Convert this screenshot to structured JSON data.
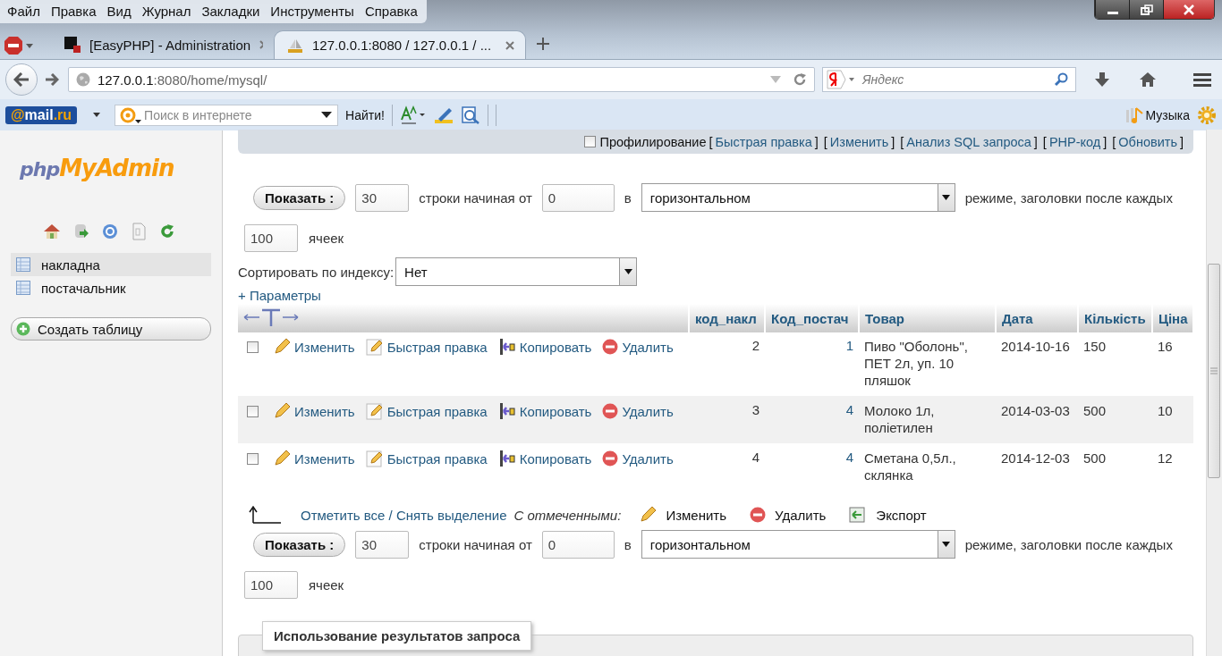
{
  "menu": [
    "Файл",
    "Правка",
    "Вид",
    "Журнал",
    "Закладки",
    "Инструменты",
    "Справка"
  ],
  "tabs": [
    {
      "title": "[EasyPHP] - Administration",
      "selected": false
    },
    {
      "title": "127.0.0.1:8080 / 127.0.0.1 / ...",
      "selected": true
    }
  ],
  "address": {
    "host": "127.0.0.1",
    "rest": ":8080/home/mysql/"
  },
  "search": {
    "placeholder": "Яндекс"
  },
  "mailbar": {
    "logo_at": "@",
    "logo_mail": "mail",
    "logo_ru": ".ru",
    "search_placeholder": "Поиск в интернете",
    "find": "Найти!",
    "music": "Музыка"
  },
  "sidebar": {
    "logo_php": "php",
    "logo_rest": "MyAdmin",
    "tables": [
      {
        "name": "накладна",
        "selected": true
      },
      {
        "name": "постачальник",
        "selected": false
      }
    ],
    "create": "Создать таблицу"
  },
  "query_bar": {
    "profiling": {
      "label": "Профилирование",
      "checked": false
    },
    "links": [
      {
        "open": "[",
        "label": "Быстрая правка",
        "close": "]"
      },
      {
        "open": "[",
        "label": "Изменить",
        "close": "]"
      },
      {
        "open": "[",
        "label": "Анализ SQL запроса",
        "close": "]"
      },
      {
        "open": "[",
        "label": "PHP-код",
        "close": "]"
      },
      {
        "open": "[",
        "label": "Обновить",
        "close": "]"
      }
    ]
  },
  "navigation": [
    {
      "button": "Показать :",
      "rows": "30",
      "from_label": "строки начиная от",
      "start": "0",
      "in_label": "в",
      "mode": "горизонтальном",
      "after_label": "режиме, заголовки после каждых",
      "cells": "100",
      "cells_label": "ячеек"
    },
    {
      "button": "Показать :",
      "rows": "30",
      "from_label": "строки начиная от",
      "start": "0",
      "in_label": "в",
      "mode": "горизонтальном",
      "after_label": "режиме, заголовки после каждых",
      "cells": "100",
      "cells_label": "ячеек"
    }
  ],
  "sort": {
    "label": "Сортировать по индексу:",
    "value": "Нет"
  },
  "options": "+ Параметры",
  "table": {
    "columns": [
      "код_накл",
      "Код_постач",
      "Товар",
      "Дата",
      "Кількість",
      "Ціна"
    ],
    "rows": [
      {
        "checked": false,
        "actions": [
          "Изменить",
          "Быстрая правка",
          "Копировать",
          "Удалить"
        ],
        "cells": [
          "2",
          "1",
          "Пиво \"Оболонь\", ПЕТ 2л, уп. 10 пляшок",
          "2014-10-16",
          "150",
          "16"
        ]
      },
      {
        "checked": false,
        "actions": [
          "Изменить",
          "Быстрая правка",
          "Копировать",
          "Удалить"
        ],
        "cells": [
          "3",
          "4",
          "Молоко 1л, полiетилен",
          "2014-03-03",
          "500",
          "10"
        ]
      },
      {
        "checked": false,
        "actions": [
          "Изменить",
          "Быстрая правка",
          "Копировать",
          "Удалить"
        ],
        "cells": [
          "4",
          "4",
          "Сметана 0,5л., склянка",
          "2014-12-03",
          "500",
          "12"
        ]
      }
    ]
  },
  "bulk": {
    "check_all": "Отметить все / Снять выделение",
    "with_selected": "С отмеченными:",
    "actions": [
      "Изменить",
      "Удалить",
      "Экспорт"
    ]
  },
  "results_section": {
    "legend": "Использование результатов запроса"
  }
}
